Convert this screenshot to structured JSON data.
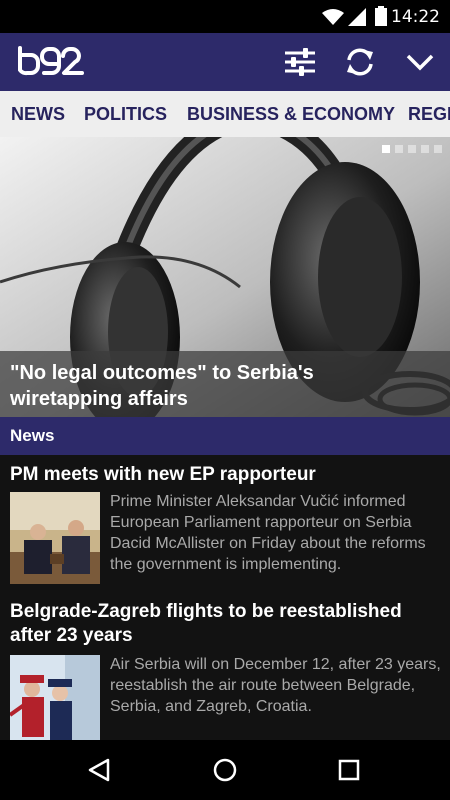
{
  "status_bar": {
    "time": "14:22"
  },
  "app_bar": {
    "logo_text": "b92",
    "icons": [
      "filter-sliders-icon",
      "refresh-icon",
      "chevron-down-icon"
    ]
  },
  "tabs": [
    "NEWS",
    "POLITICS",
    "BUSINESS & ECONOMY",
    "REGION"
  ],
  "hero": {
    "caption": "\"No legal outcomes\" to Serbia's wiretapping affairs",
    "slide_count": 5,
    "active_slide": 1
  },
  "section": {
    "title": "News"
  },
  "articles": [
    {
      "title": "PM meets with new EP rapporteur",
      "summary": "Prime Minister Aleksandar Vučić informed European Parliament rapporteur on Serbia Dacid McAllister on Friday about the reforms the government is implementing."
    },
    {
      "title": "Belgrade-Zagreb flights to be reestablished after 23 years",
      "summary": "Air Serbia will on December 12, after 23 years, reestablish the air route between Belgrade, Serbia, and Zagreb, Croatia."
    }
  ],
  "colors": {
    "brand": "#2d2a6a",
    "tab_text": "#27235e",
    "tab_bg": "#eeeeee",
    "body_bg": "#121212",
    "summary_text": "#a9a9a9"
  }
}
